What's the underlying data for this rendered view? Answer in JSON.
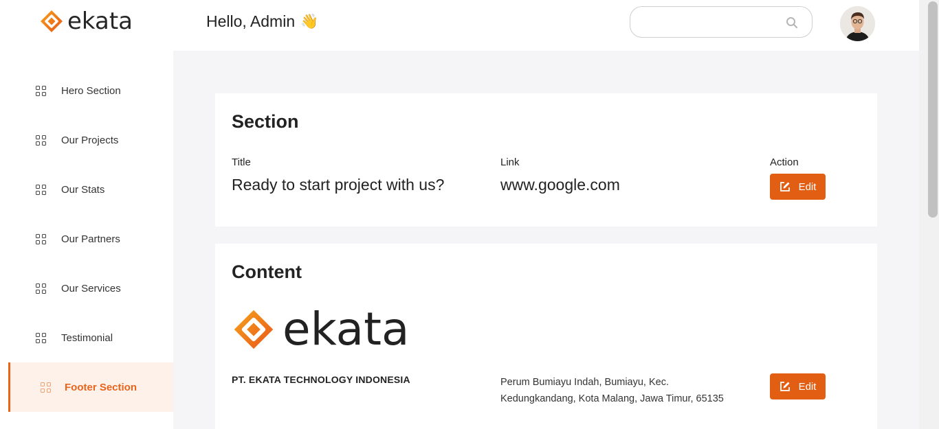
{
  "brand": {
    "name": "ekata",
    "accent": "#e8641c",
    "button_color": "#e15e13"
  },
  "sidebar": {
    "items": [
      {
        "label": "Hero Section",
        "icon": "grid-icon",
        "active": false
      },
      {
        "label": "Our Projects",
        "icon": "grid-icon",
        "active": false
      },
      {
        "label": "Our Stats",
        "icon": "grid-icon",
        "active": false
      },
      {
        "label": "Our Partners",
        "icon": "grid-icon",
        "active": false
      },
      {
        "label": "Our Services",
        "icon": "grid-icon",
        "active": false
      },
      {
        "label": "Testimonial",
        "icon": "grid-icon",
        "active": false
      },
      {
        "label": "Footer Section",
        "icon": "grid-icon",
        "active": true
      }
    ]
  },
  "header": {
    "greeting": "Hello, Admin",
    "wave_emoji": "👋",
    "search": {
      "value": "",
      "placeholder": "",
      "icon": "search-icon"
    },
    "avatar": "user-avatar"
  },
  "section_card": {
    "title": "Section",
    "columns": {
      "title_label": "Title",
      "link_label": "Link",
      "action_label": "Action"
    },
    "row": {
      "title": "Ready to start project with us?",
      "link": "www.google.com"
    },
    "edit_label": "Edit"
  },
  "content_card": {
    "title": "Content",
    "logo_text": "ekata",
    "company": "PT. EKATA TECHNOLOGY INDONESIA",
    "address_line1": "Perum Bumiayu Indah, Bumiayu, Kec.",
    "address_line2": "Kedungkandang, Kota Malang, Jawa Timur, 65135",
    "edit_label": "Edit"
  }
}
